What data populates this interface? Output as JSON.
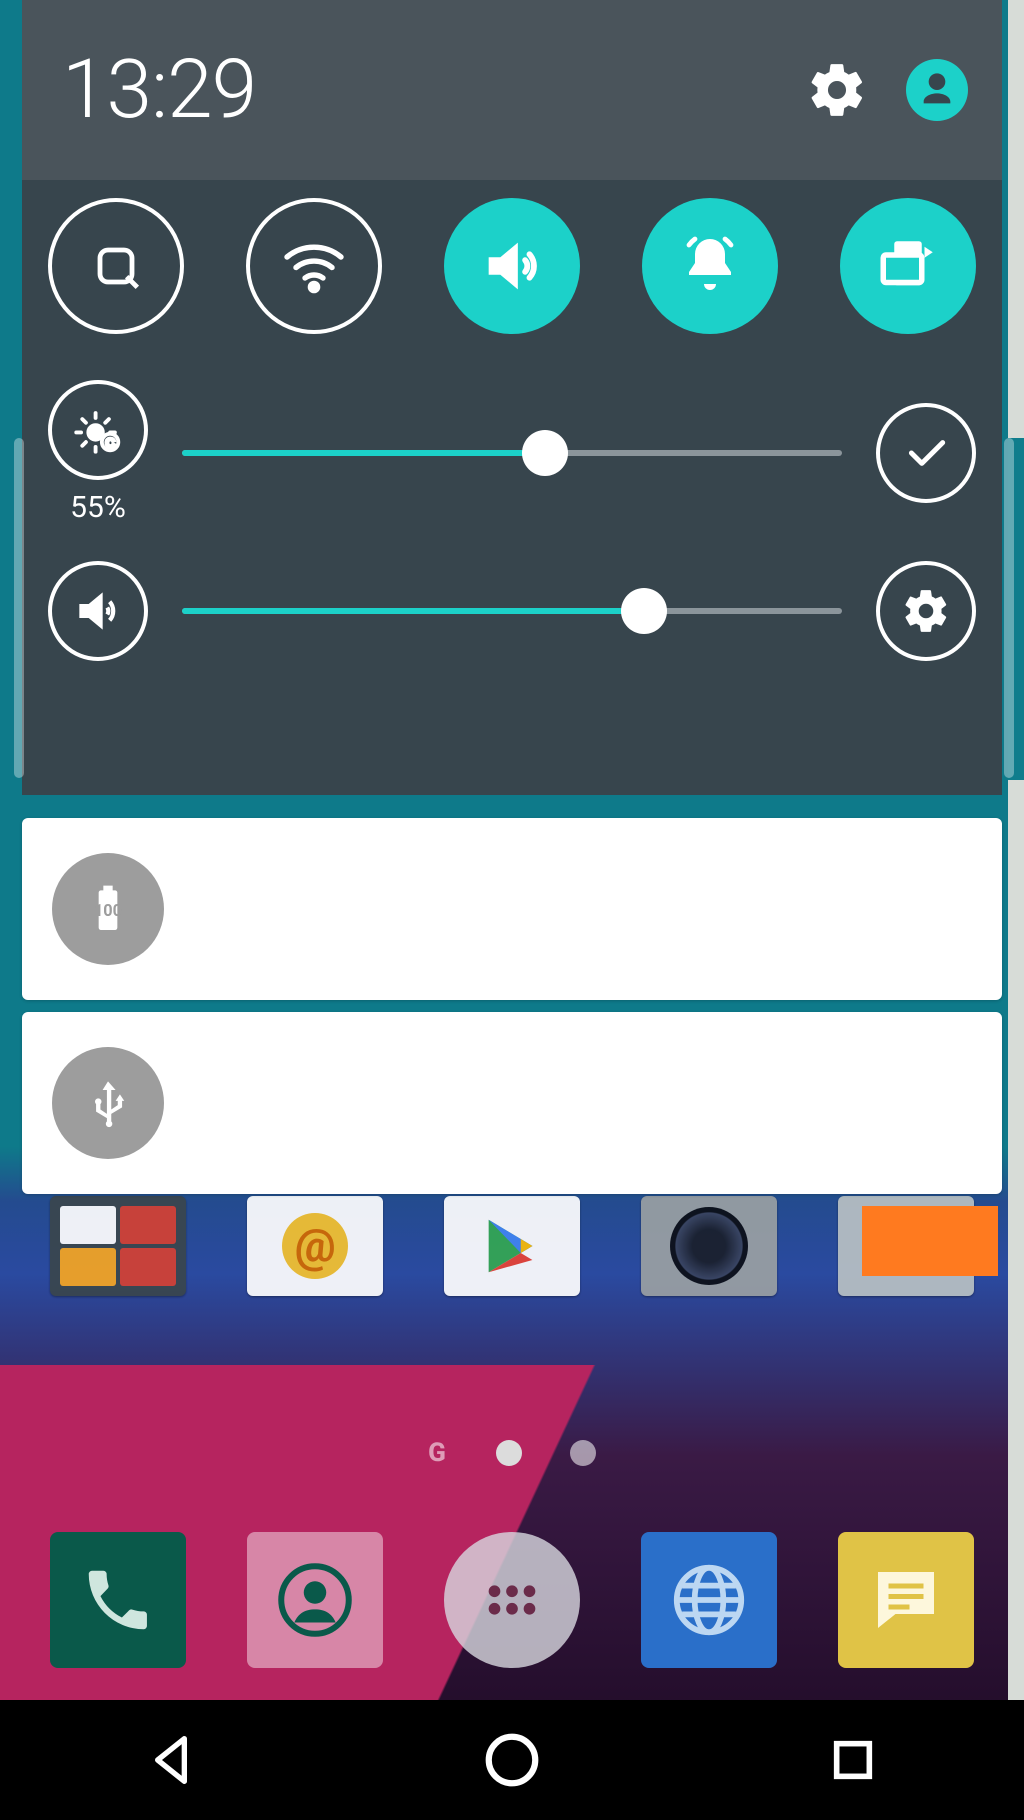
{
  "header": {
    "clock": "13:29"
  },
  "quick_toggles": [
    {
      "name": "qcircle",
      "active": false
    },
    {
      "name": "wifi",
      "active": false
    },
    {
      "name": "sound",
      "active": true
    },
    {
      "name": "vibrate",
      "active": true
    },
    {
      "name": "rotate",
      "active": true
    }
  ],
  "brightness": {
    "label": "55%",
    "percent": 55
  },
  "volume": {
    "percent": 70
  },
  "notifications": [
    {
      "icon": "battery-100"
    },
    {
      "icon": "usb"
    }
  ],
  "pager": {
    "label": "G",
    "current": 1,
    "count": 2
  },
  "colors": {
    "accent": "#1cd1c9",
    "panel_header": "#4a545b",
    "panel_body": "#37454d"
  }
}
